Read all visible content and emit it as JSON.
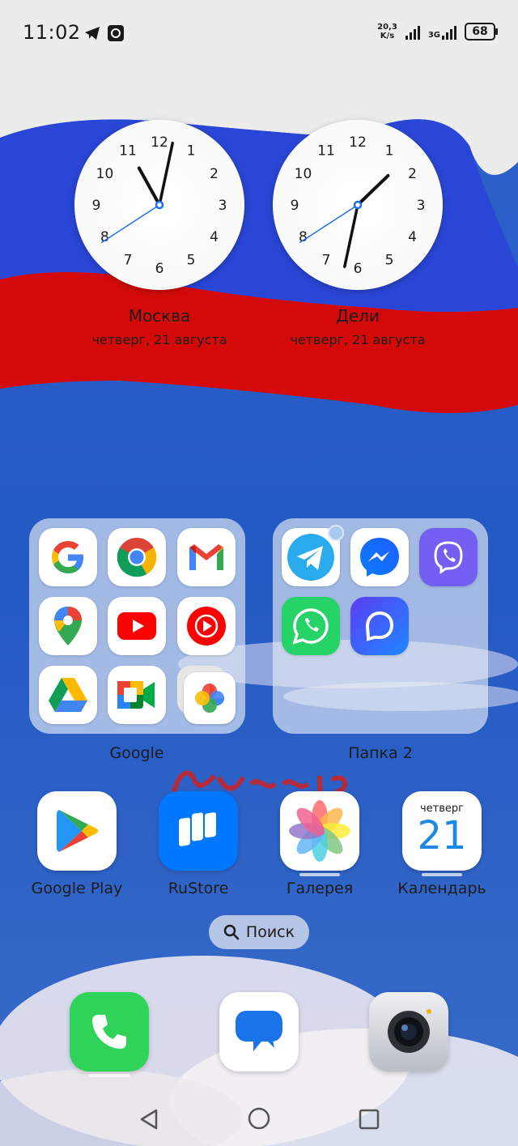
{
  "status_bar": {
    "time": "11:02",
    "net_speed_value": "20,3",
    "net_speed_unit": "K/s",
    "network_type": "3G",
    "battery": "68"
  },
  "clocks": [
    {
      "city": "Москва",
      "date": "четверг, 21 августа",
      "hour": 11,
      "minute": 2
    },
    {
      "city": "Дели",
      "date": "четверг, 21 августа",
      "hour": 13,
      "minute": 32
    }
  ],
  "folders": {
    "google": {
      "label": "Google",
      "apps": [
        "google-icon",
        "chrome-icon",
        "gmail-icon",
        "maps-icon",
        "youtube-icon",
        "youtube-music-icon",
        "drive-icon",
        "meet-icon",
        "photos-icon"
      ]
    },
    "folder2": {
      "label": "Папка 2",
      "apps": [
        "telegram-icon",
        "messenger-icon",
        "viber-icon",
        "whatsapp-icon",
        "max-icon"
      ]
    }
  },
  "apps_row": [
    {
      "label": "Google Play",
      "icon": "google-play-icon"
    },
    {
      "label": "RuStore",
      "icon": "rustore-icon"
    },
    {
      "label": "Галерея",
      "icon": "gallery-icon"
    },
    {
      "label": "Календарь",
      "icon": "calendar-icon",
      "weekday": "четверг",
      "day": "21"
    }
  ],
  "search": {
    "label": "Поиск"
  },
  "dock": [
    "phone-icon",
    "messages-icon",
    "camera-icon"
  ],
  "colors": {
    "flag_white": "#f2f2f2",
    "flag_blue": "#2a46d6",
    "flag_red": "#d40a0a",
    "sky": "#2a5fc8"
  }
}
